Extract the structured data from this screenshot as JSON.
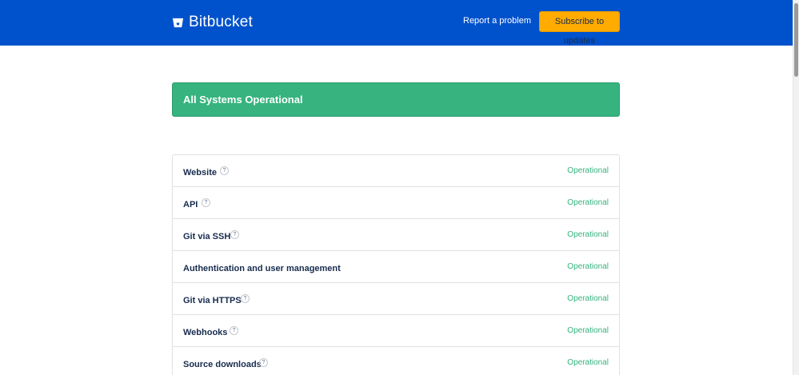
{
  "header": {
    "brand": "Bitbucket",
    "brand_icon": "bitbucket-bucket-icon",
    "report_label": "Report a problem",
    "subscribe_label": "Subscribe to updates",
    "bg_color": "#0052cc",
    "subscribe_color": "#ffab00"
  },
  "status": {
    "text": "All Systems Operational",
    "color": "#36b37e"
  },
  "components": [
    {
      "name": "Website",
      "status": "Operational",
      "has_help": true
    },
    {
      "name": "API",
      "status": "Operational",
      "has_help": true
    },
    {
      "name": "Git via SSH",
      "status": "Operational",
      "has_help": true
    },
    {
      "name": "Authentication and user management",
      "status": "Operational",
      "has_help": false
    },
    {
      "name": "Git via HTTPS",
      "status": "Operational",
      "has_help": true
    },
    {
      "name": "Webhooks",
      "status": "Operational",
      "has_help": true
    },
    {
      "name": "Source downloads",
      "status": "Operational",
      "has_help": true
    }
  ],
  "help_glyph": "?"
}
